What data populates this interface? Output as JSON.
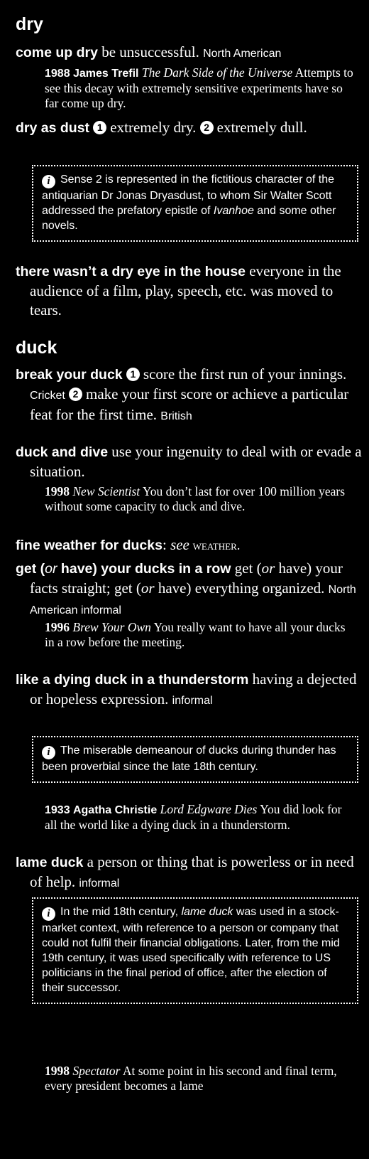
{
  "sections": {
    "dry": {
      "headword": "dry",
      "come_up_dry": {
        "phrase": "come up dry",
        "definition": " be unsuccessful. ",
        "label": "North American",
        "quote": {
          "year": "1988",
          "author": "James Trefil",
          "source": "The Dark Side of the Universe",
          "text": " Attempts to see this decay with extremely sensitive experiments have so far come up dry."
        }
      },
      "dry_as_dust": {
        "phrase": "dry as dust",
        "sense1_num": "1",
        "sense1": "extremely dry. ",
        "sense2_num": "2",
        "sense2": "extremely dull.",
        "note": {
          "icon": "i",
          "text1": "Sense 2 is represented in the fictitious character of the antiquarian Dr Jonas Dryasdust, to whom Sir Walter Scott addressed the prefatory epistle of ",
          "italic": "Ivanhoe",
          "text2": " and some other novels."
        }
      },
      "dry_eye": {
        "phrase": "there wasn’t a dry eye in the house",
        "definition": " everyone in the audience of a film, play, speech, etc. was moved to tears."
      }
    },
    "duck": {
      "headword": "duck",
      "break_your_duck": {
        "phrase": "break your duck",
        "sense1_num": "1",
        "sense1": "score the first run of your innings. ",
        "label1": "Cricket",
        "sense2_num": "2",
        "sense2": "make your first score or achieve a particular feat for the first time. ",
        "label2": "British"
      },
      "duck_and_dive": {
        "phrase": "duck and dive",
        "definition": " use your ingenuity to deal with or evade a situation.",
        "quote": {
          "year": "1998",
          "source": "New Scientist",
          "text": " You don’t last for over 100 million years without some capacity to duck and dive."
        }
      },
      "fine_weather": {
        "phrase": "fine weather for ducks",
        "colon": ": ",
        "see": "see",
        "xref": " weather."
      },
      "ducks_in_a_row": {
        "phrase_a": "get (",
        "or_a": "or",
        "phrase_b": " have) your ducks in a row",
        "def_a": " get (",
        "or_b": "or",
        "def_b": " have) your facts straight; get (",
        "or_c": "or",
        "def_c": " have) everything organized. ",
        "label": "North American informal",
        "quote": {
          "year": "1996",
          "source": "Brew Your Own",
          "text": " You really want to have all your ducks in a row before the meeting."
        }
      },
      "dying_duck": {
        "phrase": "like a dying duck in a thunderstorm",
        "definition": " having a dejected or hopeless expression. ",
        "label": "informal",
        "note": {
          "icon": "i",
          "text": "The miserable demeanour of ducks during thunder has been proverbial since the late 18th century."
        },
        "quote": {
          "year": "1933",
          "author": "Agatha Christie",
          "source": "Lord Edgware Dies",
          "text": " You did look for all the world like a dying duck in a thunderstorm."
        }
      },
      "lame_duck": {
        "phrase": "lame duck",
        "definition": " a person or thing that is powerless or in need of help. ",
        "label": "informal",
        "note": {
          "icon": "i",
          "text1": "In the mid 18th century, ",
          "italic": "lame duck",
          "text2": " was used in a stock-market context, with reference to a person or company that could not fulfil their financial obligations. Later, from the mid 19th century, it was used specifically with reference to US politicians in the final period of office, after the election of their successor."
        },
        "quote": {
          "year": "1998",
          "source": "Spectator",
          "text": " At some point in his second and final term, every president becomes a lame"
        }
      }
    }
  }
}
